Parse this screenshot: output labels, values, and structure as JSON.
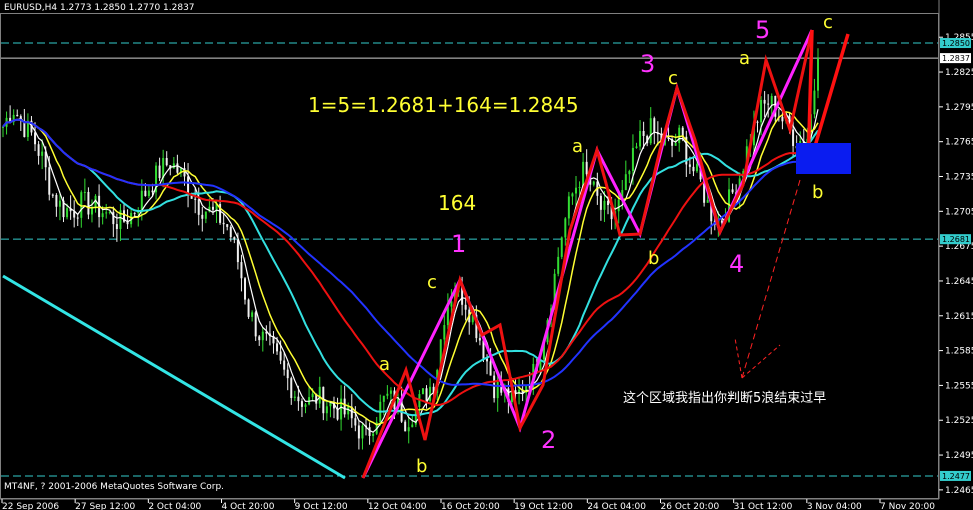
{
  "window": {
    "symbol_line": "EURUSD,H4  1.2773 1.2850 1.2770 1.2837",
    "copyright": "MT4NF, ? 2001-2006 MetaQuotes Software Corp."
  },
  "chart_data": {
    "type": "candlestick",
    "symbol": "EURUSD",
    "timeframe": "H4",
    "ohlc_last": {
      "open": 1.2773,
      "high": 1.285,
      "low": 1.277,
      "close": 1.2837
    },
    "ylim": [
      1.2458,
      1.2875
    ],
    "y_ticks": [
      "1.2855",
      "1.2825",
      "1.2795",
      "1.2765",
      "1.2735",
      "1.2705",
      "1.2675",
      "1.2645",
      "1.2615",
      "1.2585",
      "1.2555",
      "1.2525",
      "1.2495",
      "1.2465"
    ],
    "x_ticks": [
      "22 Sep 2006",
      "27 Sep 12:00",
      "2 Oct 04:00",
      "4 Oct 20:00",
      "9 Oct 12:00",
      "12 Oct 04:00",
      "16 Oct 20:00",
      "19 Oct 12:00",
      "24 Oct 04:00",
      "26 Oct 20:00",
      "31 Oct 12:00",
      "3 Nov 04:00",
      "7 Nov 20:00"
    ],
    "price_labels": [
      {
        "text": "1.2850",
        "value": 1.285,
        "style": "dashed-cyan"
      },
      {
        "text": "1.2837",
        "value": 1.2837,
        "style": "solid-white"
      },
      {
        "text": "1.2681",
        "value": 1.2681,
        "style": "dashed-cyan"
      },
      {
        "text": "1.2477",
        "value": 1.2477,
        "style": "dashed-cyan"
      }
    ],
    "close_path": [
      1.2778,
      1.2795,
      1.278,
      1.277,
      1.275,
      1.272,
      1.2708,
      1.2705,
      1.2712,
      1.271,
      1.2706,
      1.27,
      1.2695,
      1.2702,
      1.2715,
      1.2728,
      1.274,
      1.2748,
      1.2738,
      1.2725,
      1.271,
      1.2705,
      1.27,
      1.269,
      1.266,
      1.262,
      1.26,
      1.259,
      1.2575,
      1.256,
      1.2545,
      1.254,
      1.2545,
      1.254,
      1.2535,
      1.253,
      1.252,
      1.251,
      1.253,
      1.2545,
      1.254,
      1.2525,
      1.2535,
      1.2548,
      1.256,
      1.262,
      1.264,
      1.263,
      1.261,
      1.2585,
      1.2555,
      1.2548,
      1.254,
      1.2555,
      1.2565,
      1.2595,
      1.264,
      1.269,
      1.272,
      1.274,
      1.2725,
      1.2705,
      1.27,
      1.2715,
      1.2745,
      1.277,
      1.2775,
      1.2765,
      1.276,
      1.277,
      1.2745,
      1.273,
      1.2705,
      1.2695,
      1.2715,
      1.2735,
      1.2765,
      1.279,
      1.28,
      1.279,
      1.2775,
      1.2765,
      1.277,
      1.2837
    ],
    "annotations": [
      {
        "text": "5",
        "color": "magenta"
      },
      {
        "text": "c",
        "color": "yellow"
      },
      {
        "text": "3",
        "color": "magenta"
      },
      {
        "text": "c",
        "color": "yellow"
      },
      {
        "text": "a",
        "color": "yellow"
      },
      {
        "text": "a",
        "color": "yellow"
      },
      {
        "text": "1=5=1.2681+164=1.2845",
        "color": "yellow"
      },
      {
        "text": "164",
        "color": "yellow"
      },
      {
        "text": "1",
        "color": "magenta"
      },
      {
        "text": "b",
        "color": "yellow"
      },
      {
        "text": "b",
        "color": "yellow"
      },
      {
        "text": "4",
        "color": "magenta"
      },
      {
        "text": "c",
        "color": "yellow"
      },
      {
        "text": "a",
        "color": "yellow"
      },
      {
        "text": "2",
        "color": "magenta"
      },
      {
        "text": "b",
        "color": "yellow"
      },
      {
        "text": "这个区域我指出你判断5浪结束过早",
        "color": "white"
      }
    ]
  }
}
